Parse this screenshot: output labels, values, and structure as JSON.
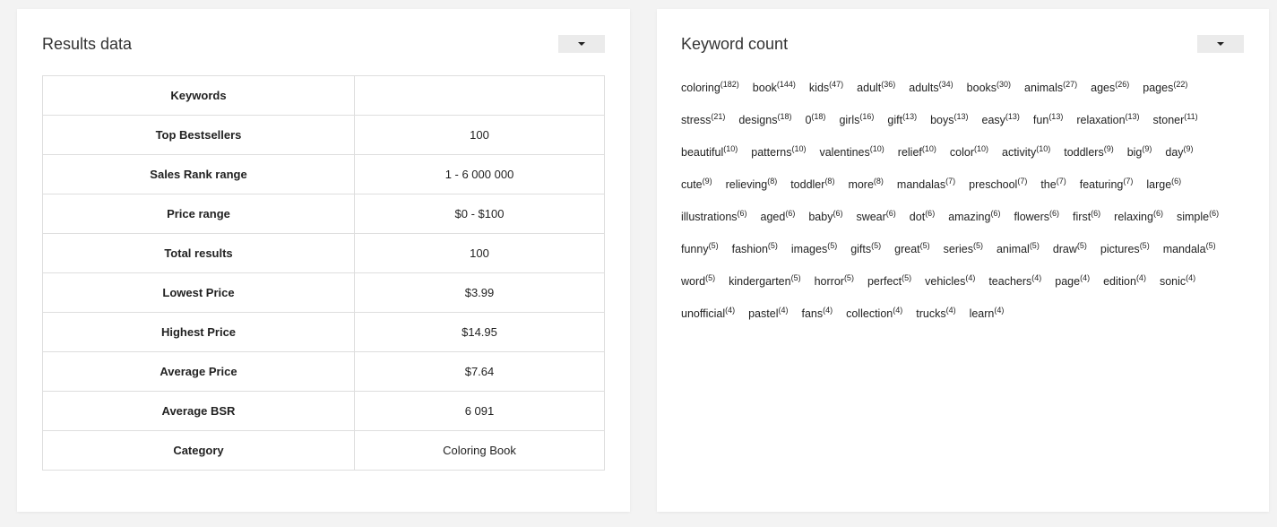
{
  "results_panel": {
    "title": "Results data",
    "rows": [
      {
        "key": "Keywords",
        "value": ""
      },
      {
        "key": "Top Bestsellers",
        "value": "100"
      },
      {
        "key": "Sales Rank range",
        "value": "1 - 6 000 000"
      },
      {
        "key": "Price range",
        "value": "$0 - $100"
      },
      {
        "key": "Total results",
        "value": "100"
      },
      {
        "key": "Lowest Price",
        "value": "$3.99"
      },
      {
        "key": "Highest Price",
        "value": "$14.95"
      },
      {
        "key": "Average Price",
        "value": "$7.64"
      },
      {
        "key": "Average BSR",
        "value": "6 091"
      },
      {
        "key": "Category",
        "value": "Coloring Book"
      }
    ]
  },
  "keyword_panel": {
    "title": "Keyword count",
    "keywords": [
      {
        "word": "coloring",
        "count": "(182)"
      },
      {
        "word": "book",
        "count": "(144)"
      },
      {
        "word": "kids",
        "count": "(47)"
      },
      {
        "word": "adult",
        "count": "(36)"
      },
      {
        "word": "adults",
        "count": "(34)"
      },
      {
        "word": "books",
        "count": "(30)"
      },
      {
        "word": "animals",
        "count": "(27)"
      },
      {
        "word": "ages",
        "count": "(26)"
      },
      {
        "word": "pages",
        "count": "(22)"
      },
      {
        "word": "stress",
        "count": "(21)"
      },
      {
        "word": "designs",
        "count": "(18)"
      },
      {
        "word": "0",
        "count": "(18)"
      },
      {
        "word": "girls",
        "count": "(16)"
      },
      {
        "word": "gift",
        "count": "(13)"
      },
      {
        "word": "boys",
        "count": "(13)"
      },
      {
        "word": "easy",
        "count": "(13)"
      },
      {
        "word": "fun",
        "count": "(13)"
      },
      {
        "word": "relaxation",
        "count": "(13)"
      },
      {
        "word": "stoner",
        "count": "(11)"
      },
      {
        "word": "beautiful",
        "count": "(10)"
      },
      {
        "word": "patterns",
        "count": "(10)"
      },
      {
        "word": "valentines",
        "count": "(10)"
      },
      {
        "word": "relief",
        "count": "(10)"
      },
      {
        "word": "color",
        "count": "(10)"
      },
      {
        "word": "activity",
        "count": "(10)"
      },
      {
        "word": "toddlers",
        "count": "(9)"
      },
      {
        "word": "big",
        "count": "(9)"
      },
      {
        "word": "day",
        "count": "(9)"
      },
      {
        "word": "cute",
        "count": "(9)"
      },
      {
        "word": "relieving",
        "count": "(8)"
      },
      {
        "word": "toddler",
        "count": "(8)"
      },
      {
        "word": "more",
        "count": "(8)"
      },
      {
        "word": "mandalas",
        "count": "(7)"
      },
      {
        "word": "preschool",
        "count": "(7)"
      },
      {
        "word": "the",
        "count": "(7)"
      },
      {
        "word": "featuring",
        "count": "(7)"
      },
      {
        "word": "large",
        "count": "(6)"
      },
      {
        "word": "illustrations",
        "count": "(6)"
      },
      {
        "word": "aged",
        "count": "(6)"
      },
      {
        "word": "baby",
        "count": "(6)"
      },
      {
        "word": "swear",
        "count": "(6)"
      },
      {
        "word": "dot",
        "count": "(6)"
      },
      {
        "word": "amazing",
        "count": "(6)"
      },
      {
        "word": "flowers",
        "count": "(6)"
      },
      {
        "word": "first",
        "count": "(6)"
      },
      {
        "word": "relaxing",
        "count": "(6)"
      },
      {
        "word": "simple",
        "count": "(6)"
      },
      {
        "word": "funny",
        "count": "(5)"
      },
      {
        "word": "fashion",
        "count": "(5)"
      },
      {
        "word": "images",
        "count": "(5)"
      },
      {
        "word": "gifts",
        "count": "(5)"
      },
      {
        "word": "great",
        "count": "(5)"
      },
      {
        "word": "series",
        "count": "(5)"
      },
      {
        "word": "animal",
        "count": "(5)"
      },
      {
        "word": "draw",
        "count": "(5)"
      },
      {
        "word": "pictures",
        "count": "(5)"
      },
      {
        "word": "mandala",
        "count": "(5)"
      },
      {
        "word": "word",
        "count": "(5)"
      },
      {
        "word": "kindergarten",
        "count": "(5)"
      },
      {
        "word": "horror",
        "count": "(5)"
      },
      {
        "word": "perfect",
        "count": "(5)"
      },
      {
        "word": "vehicles",
        "count": "(4)"
      },
      {
        "word": "teachers",
        "count": "(4)"
      },
      {
        "word": "page",
        "count": "(4)"
      },
      {
        "word": "edition",
        "count": "(4)"
      },
      {
        "word": "sonic",
        "count": "(4)"
      },
      {
        "word": "unofficial",
        "count": "(4)"
      },
      {
        "word": "pastel",
        "count": "(4)"
      },
      {
        "word": "fans",
        "count": "(4)"
      },
      {
        "word": "collection",
        "count": "(4)"
      },
      {
        "word": "trucks",
        "count": "(4)"
      },
      {
        "word": "learn",
        "count": "(4)"
      }
    ]
  },
  "icons": {
    "dropdown": "caret-down-icon"
  },
  "colors": {
    "page_background": "#f3f3f3",
    "card_background": "#ffffff",
    "table_border": "#dedede",
    "dropdown_button": "#ebebeb"
  }
}
